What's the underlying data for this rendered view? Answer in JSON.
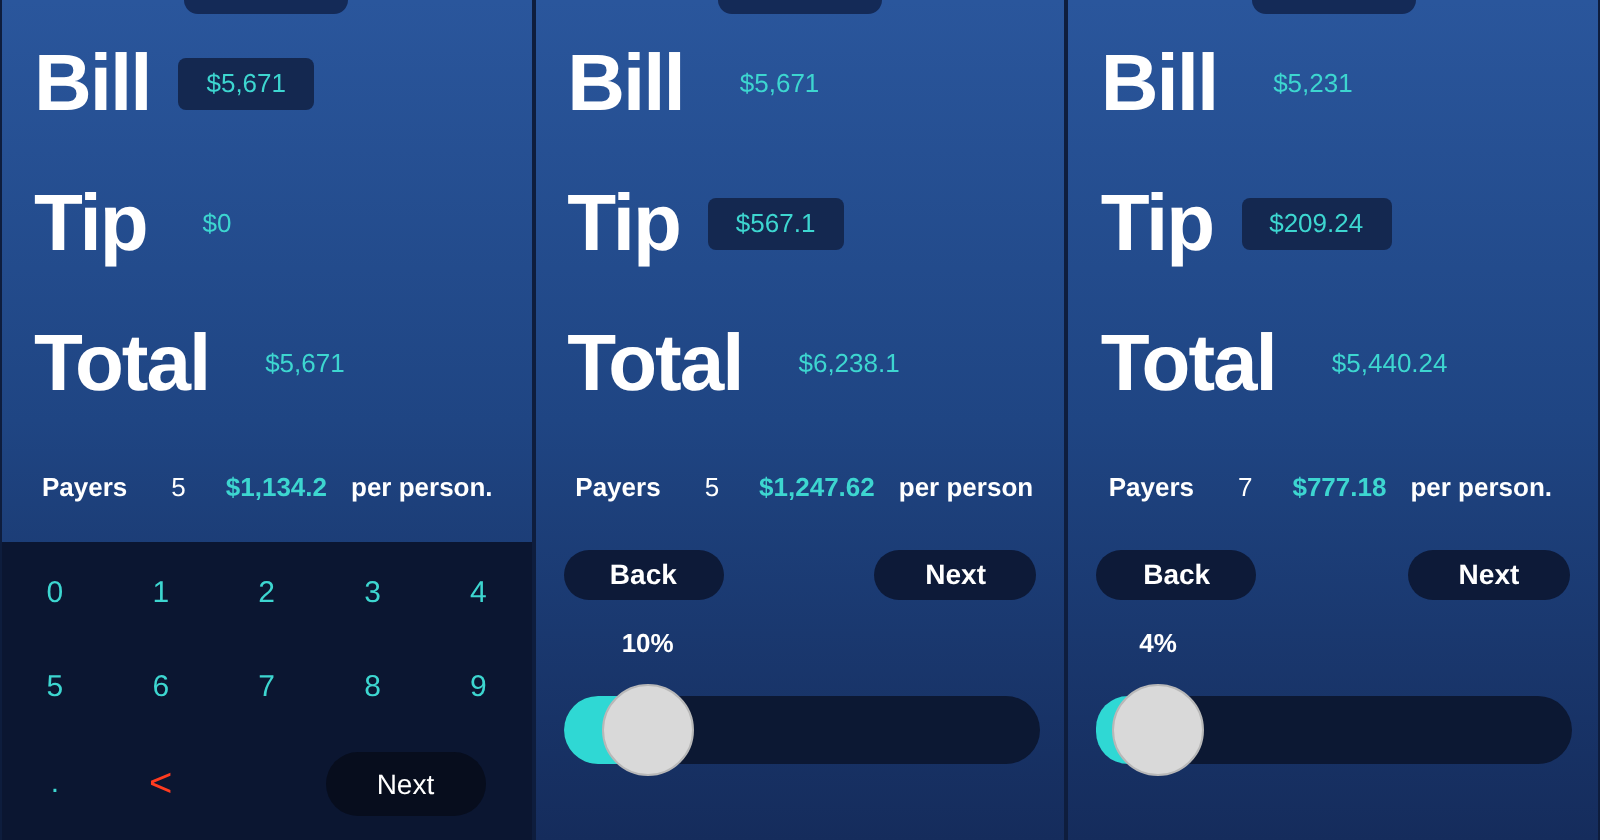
{
  "screens": [
    {
      "fields": [
        {
          "label": "Bill",
          "value": "$5,671",
          "active": true
        },
        {
          "label": "Tip",
          "value": "$0",
          "active": false
        },
        {
          "label": "Total",
          "value": "$5,671",
          "active": false
        }
      ],
      "payers": {
        "label": "Payers",
        "count": "5",
        "amount": "$1,134.2",
        "suffix": "per person."
      },
      "controls": {
        "kind": "keypad",
        "keys": [
          {
            "label": "0",
            "kind": "digit"
          },
          {
            "label": "1",
            "kind": "digit"
          },
          {
            "label": "2",
            "kind": "digit"
          },
          {
            "label": "3",
            "kind": "digit"
          },
          {
            "label": "4",
            "kind": "digit"
          },
          {
            "label": "5",
            "kind": "digit"
          },
          {
            "label": "6",
            "kind": "digit"
          },
          {
            "label": "7",
            "kind": "digit"
          },
          {
            "label": "8",
            "kind": "digit"
          },
          {
            "label": "9",
            "kind": "digit"
          },
          {
            "label": ".",
            "kind": "digit"
          },
          {
            "label": "<",
            "kind": "delete"
          }
        ],
        "next": "Next"
      }
    },
    {
      "fields": [
        {
          "label": "Bill",
          "value": "$5,671",
          "active": false
        },
        {
          "label": "Tip",
          "value": "$567.1",
          "active": true
        },
        {
          "label": "Total",
          "value": "$6,238.1",
          "active": false
        }
      ],
      "payers": {
        "label": "Payers",
        "count": "5",
        "amount": "$1,247.62",
        "suffix": "per person"
      },
      "controls": {
        "kind": "tip",
        "back": "Back",
        "next": "Next",
        "percent": "10%",
        "level": 0.1
      }
    },
    {
      "fields": [
        {
          "label": "Bill",
          "value": "$5,231",
          "active": false
        },
        {
          "label": "Tip",
          "value": "$209.24",
          "active": true
        },
        {
          "label": "Total",
          "value": "$5,440.24",
          "active": false
        }
      ],
      "payers": {
        "label": "Payers",
        "count": "7",
        "amount": "$777.18",
        "suffix": "per person."
      },
      "controls": {
        "kind": "tip",
        "back": "Back",
        "next": "Next",
        "percent": "4%",
        "level": 0.04
      }
    }
  ]
}
